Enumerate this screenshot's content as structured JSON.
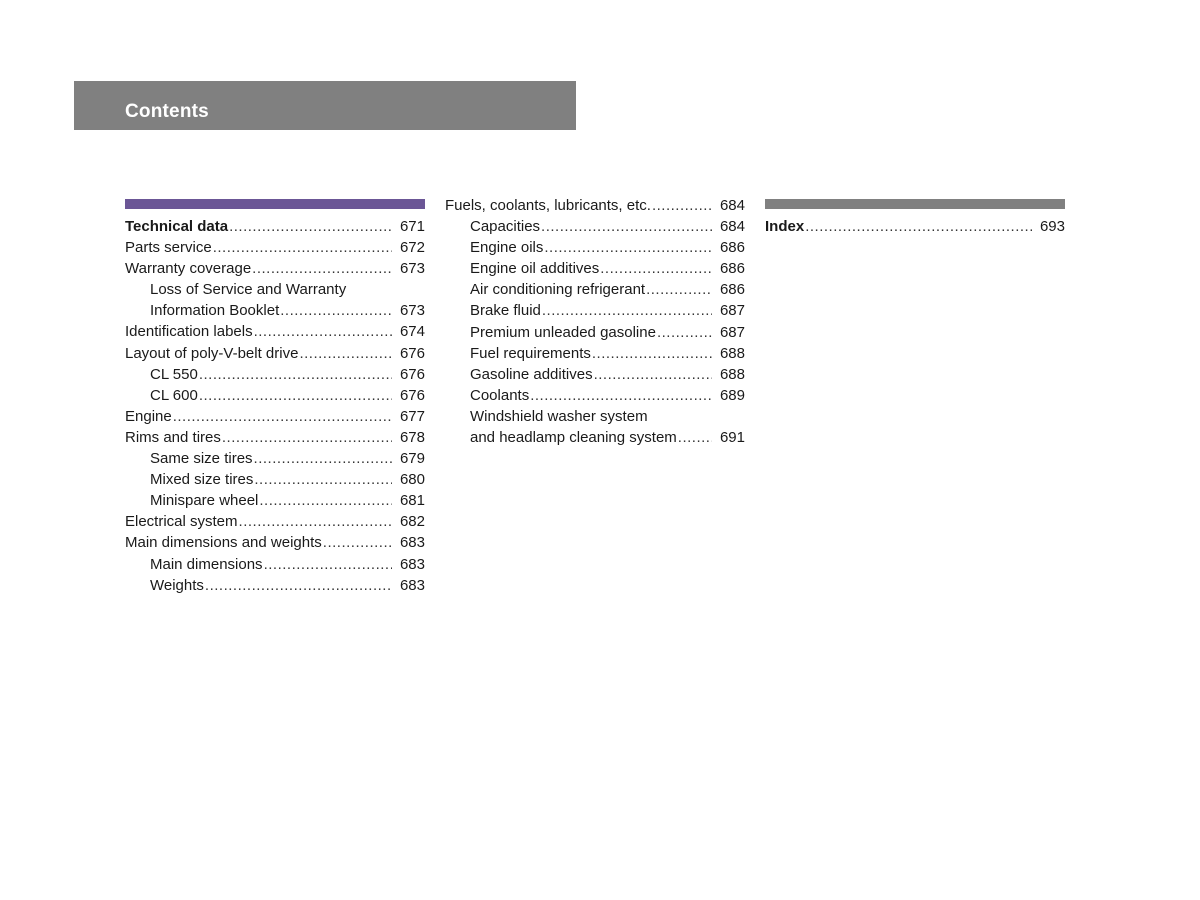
{
  "header": {
    "title": "Contents"
  },
  "colors": {
    "header_bg": "#808080",
    "section_bar_technical": "#6b5696",
    "section_bar_index": "#808080"
  },
  "columns": [
    {
      "entries": [
        {
          "label": "Technical data",
          "page": "671",
          "level": 0,
          "bold": true
        },
        {
          "label": "Parts service",
          "page": "672",
          "level": 0
        },
        {
          "label": "Warranty coverage",
          "page": "673",
          "level": 0
        },
        {
          "label": "Loss of Service and Warranty",
          "page": "",
          "level": 1
        },
        {
          "label": "Information Booklet",
          "page": "673",
          "level": 1
        },
        {
          "label": "Identification labels",
          "page": "674",
          "level": 0
        },
        {
          "label": "Layout of poly-V-belt drive",
          "page": "676",
          "level": 0
        },
        {
          "label": "CL 550",
          "page": "676",
          "level": 1
        },
        {
          "label": "CL 600",
          "page": "676",
          "level": 1
        },
        {
          "label": "Engine",
          "page": "677",
          "level": 0
        },
        {
          "label": "Rims and tires",
          "page": "678",
          "level": 0
        },
        {
          "label": "Same size tires",
          "page": "679",
          "level": 1
        },
        {
          "label": "Mixed size tires",
          "page": "680",
          "level": 1
        },
        {
          "label": "Minispare wheel",
          "page": "681",
          "level": 1
        },
        {
          "label": "Electrical system",
          "page": "682",
          "level": 0
        },
        {
          "label": "Main dimensions and weights",
          "page": "683",
          "level": 0
        },
        {
          "label": "Main dimensions",
          "page": "683",
          "level": 1
        },
        {
          "label": "Weights",
          "page": "683",
          "level": 1
        }
      ]
    },
    {
      "entries": [
        {
          "label": "Fuels, coolants, lubricants, etc.",
          "page": "684",
          "level": 0
        },
        {
          "label": "Capacities",
          "page": "684",
          "level": 1
        },
        {
          "label": "Engine oils",
          "page": "686",
          "level": 1
        },
        {
          "label": "Engine oil additives",
          "page": "686",
          "level": 1
        },
        {
          "label": "Air conditioning refrigerant",
          "page": "686",
          "level": 1
        },
        {
          "label": "Brake fluid",
          "page": "687",
          "level": 1
        },
        {
          "label": "Premium unleaded gasoline",
          "page": "687",
          "level": 1
        },
        {
          "label": "Fuel requirements",
          "page": "688",
          "level": 1
        },
        {
          "label": "Gasoline additives",
          "page": "688",
          "level": 1
        },
        {
          "label": "Coolants",
          "page": "689",
          "level": 1
        },
        {
          "label": "Windshield washer system",
          "page": "",
          "level": 1
        },
        {
          "label": "and headlamp cleaning system",
          "page": "691",
          "level": 1
        }
      ]
    },
    {
      "entries": [
        {
          "label": "Index",
          "page": "693",
          "level": 0,
          "bold": true
        }
      ]
    }
  ]
}
